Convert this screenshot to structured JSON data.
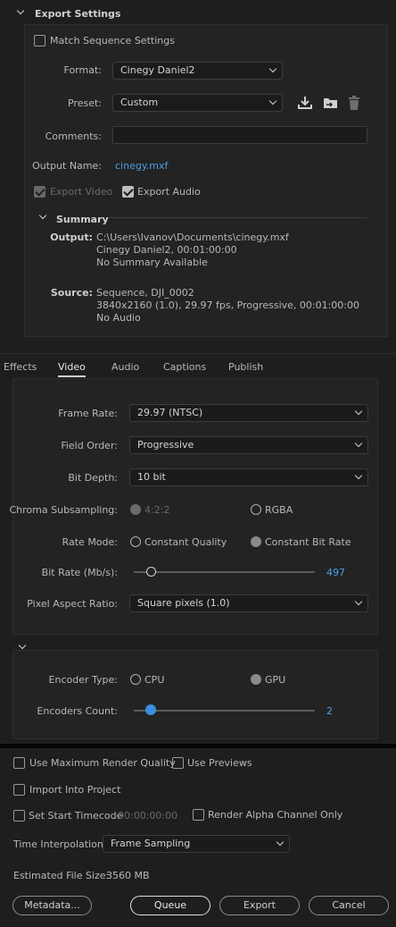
{
  "export_settings": {
    "title": "Export Settings",
    "match_sequence_label": "Match Sequence Settings",
    "format_label": "Format:",
    "format_value": "Cinegy Daniel2",
    "preset_label": "Preset:",
    "preset_value": "Custom",
    "comments_label": "Comments:",
    "comments_value": "",
    "output_name_label": "Output Name:",
    "output_name_value": "cinegy.mxf",
    "export_video_label": "Export Video",
    "export_audio_label": "Export Audio",
    "summary_title": "Summary",
    "output_label": "Output:",
    "output_lines": [
      "C:\\Users\\Ivanov\\Documents\\cinegy.mxf",
      "Cinegy Daniel2, 00:01:00:00",
      "No Summary Available"
    ],
    "source_label": "Source:",
    "source_lines": [
      "Sequence, DJI_0002",
      "3840x2160 (1.0), 29.97 fps, Progressive, 00:01:00:00",
      "No Audio"
    ]
  },
  "tabs": [
    "Effects",
    "Video",
    "Audio",
    "Captions",
    "Publish"
  ],
  "active_tab": "Video",
  "video": {
    "frame_rate_label": "Frame Rate:",
    "frame_rate_value": "29.97 (NTSC)",
    "field_order_label": "Field Order:",
    "field_order_value": "Progressive",
    "bit_depth_label": "Bit Depth:",
    "bit_depth_value": "10 bit",
    "chroma_label": "Chroma Subsampling:",
    "chroma_opt1": "4:2:2",
    "chroma_opt2": "RGBA",
    "rate_mode_label": "Rate Mode:",
    "rate_mode_opt1": "Constant Quality",
    "rate_mode_opt2": "Constant Bit Rate",
    "bit_rate_label": "Bit Rate (Mb/s):",
    "bit_rate_value": "497",
    "pixel_aspect_label": "Pixel Aspect Ratio:",
    "pixel_aspect_value": "Square pixels (1.0)"
  },
  "encoder": {
    "type_label": "Encoder Type:",
    "type_opt1": "CPU",
    "type_opt2": "GPU",
    "count_label": "Encoders Count:",
    "count_value": "2"
  },
  "bottom": {
    "max_render_label": "Use Maximum Render Quality",
    "use_previews_label": "Use Previews",
    "import_label": "Import Into Project",
    "set_start_label": "Set Start Timecode",
    "timecode_value": "00:00:00:00",
    "render_alpha_label": "Render Alpha Channel Only",
    "time_interp_label": "Time Interpolation:",
    "time_interp_value": "Frame Sampling",
    "file_size_label": "Estimated File Size:",
    "file_size_value": "3560 MB",
    "metadata_button": "Metadata...",
    "queue_button": "Queue",
    "export_button": "Export",
    "cancel_button": "Cancel"
  },
  "colors": {
    "accent": "#3a8fe0",
    "link": "#4a9ee8"
  }
}
